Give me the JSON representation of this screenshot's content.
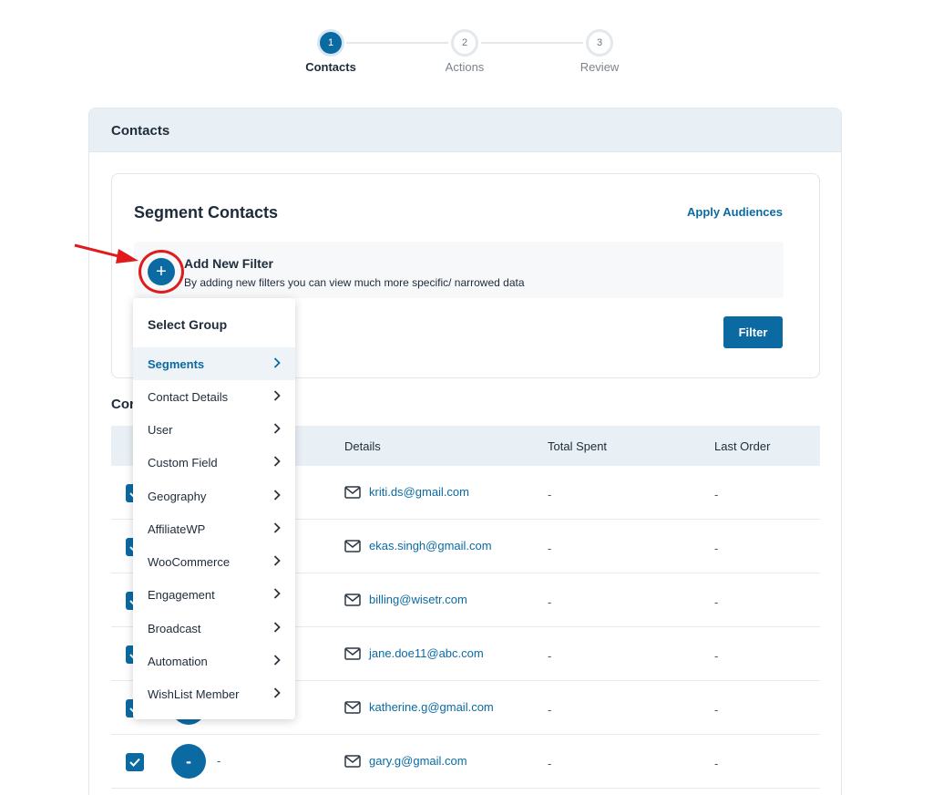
{
  "stepper": {
    "steps": [
      {
        "number": "1",
        "label": "Contacts",
        "state": "active"
      },
      {
        "number": "2",
        "label": "Actions",
        "state": "inactive"
      },
      {
        "number": "3",
        "label": "Review",
        "state": "inactive"
      }
    ]
  },
  "card": {
    "header": "Contacts"
  },
  "segment": {
    "title": "Segment Contacts",
    "apply_link": "Apply Audiences",
    "add_filter_title": "Add New Filter",
    "add_filter_desc": "By adding new filters you can view much more specific/ narrowed data",
    "plus_symbol": "+",
    "filter_button": "Filter"
  },
  "dropdown": {
    "title": "Select Group",
    "items": [
      {
        "label": "Segments",
        "selected": true
      },
      {
        "label": "Contact Details",
        "selected": false
      },
      {
        "label": "User",
        "selected": false
      },
      {
        "label": "Custom Field",
        "selected": false
      },
      {
        "label": "Geography",
        "selected": false
      },
      {
        "label": "AffiliateWP",
        "selected": false
      },
      {
        "label": "WooCommerce",
        "selected": false
      },
      {
        "label": "Engagement",
        "selected": false
      },
      {
        "label": "Broadcast",
        "selected": false
      },
      {
        "label": "Automation",
        "selected": false
      },
      {
        "label": "WishList Member",
        "selected": false
      }
    ]
  },
  "contacts_table": {
    "heading": "Cor",
    "columns": {
      "details": "Details",
      "total_spent": "Total Spent",
      "last_order": "Last Order"
    },
    "rows": [
      {
        "email": "kriti.ds@gmail.com",
        "total_spent": "-",
        "last_order": "-"
      },
      {
        "email": "ekas.singh@gmail.com",
        "total_spent": "-",
        "last_order": "-"
      },
      {
        "email": "billing@wisetr.com",
        "total_spent": "-",
        "last_order": "-"
      },
      {
        "email": "jane.doe11@abc.com",
        "total_spent": "-",
        "last_order": "-"
      },
      {
        "email": "katherine.g@gmail.com",
        "total_spent": "-",
        "last_order": "-"
      },
      {
        "email": "gary.g@gmail.com",
        "total_spent": "-",
        "last_order": "-",
        "avatar": "-",
        "name": "-"
      }
    ]
  },
  "colors": {
    "accent": "#0b6aa2",
    "header_bg": "#e9f0f5",
    "annotation": "#e01b1b"
  },
  "icons": {
    "checkbox": "check-icon",
    "mail": "mail-icon",
    "chevron": "chevron-right-icon",
    "plus": "plus-icon",
    "annotation_arrow": "arrow-right-icon"
  }
}
